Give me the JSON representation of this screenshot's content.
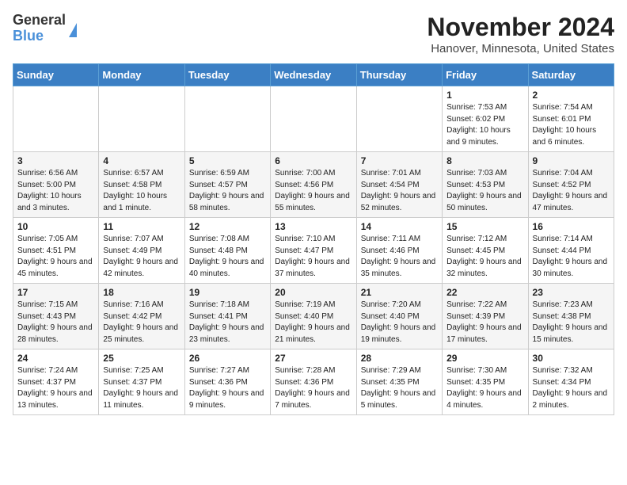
{
  "header": {
    "logo_line1": "General",
    "logo_line2": "Blue",
    "title": "November 2024",
    "subtitle": "Hanover, Minnesota, United States"
  },
  "calendar": {
    "weekdays": [
      "Sunday",
      "Monday",
      "Tuesday",
      "Wednesday",
      "Thursday",
      "Friday",
      "Saturday"
    ],
    "weeks": [
      [
        {
          "day": "",
          "info": ""
        },
        {
          "day": "",
          "info": ""
        },
        {
          "day": "",
          "info": ""
        },
        {
          "day": "",
          "info": ""
        },
        {
          "day": "",
          "info": ""
        },
        {
          "day": "1",
          "info": "Sunrise: 7:53 AM\nSunset: 6:02 PM\nDaylight: 10 hours and 9 minutes."
        },
        {
          "day": "2",
          "info": "Sunrise: 7:54 AM\nSunset: 6:01 PM\nDaylight: 10 hours and 6 minutes."
        }
      ],
      [
        {
          "day": "3",
          "info": "Sunrise: 6:56 AM\nSunset: 5:00 PM\nDaylight: 10 hours and 3 minutes."
        },
        {
          "day": "4",
          "info": "Sunrise: 6:57 AM\nSunset: 4:58 PM\nDaylight: 10 hours and 1 minute."
        },
        {
          "day": "5",
          "info": "Sunrise: 6:59 AM\nSunset: 4:57 PM\nDaylight: 9 hours and 58 minutes."
        },
        {
          "day": "6",
          "info": "Sunrise: 7:00 AM\nSunset: 4:56 PM\nDaylight: 9 hours and 55 minutes."
        },
        {
          "day": "7",
          "info": "Sunrise: 7:01 AM\nSunset: 4:54 PM\nDaylight: 9 hours and 52 minutes."
        },
        {
          "day": "8",
          "info": "Sunrise: 7:03 AM\nSunset: 4:53 PM\nDaylight: 9 hours and 50 minutes."
        },
        {
          "day": "9",
          "info": "Sunrise: 7:04 AM\nSunset: 4:52 PM\nDaylight: 9 hours and 47 minutes."
        }
      ],
      [
        {
          "day": "10",
          "info": "Sunrise: 7:05 AM\nSunset: 4:51 PM\nDaylight: 9 hours and 45 minutes."
        },
        {
          "day": "11",
          "info": "Sunrise: 7:07 AM\nSunset: 4:49 PM\nDaylight: 9 hours and 42 minutes."
        },
        {
          "day": "12",
          "info": "Sunrise: 7:08 AM\nSunset: 4:48 PM\nDaylight: 9 hours and 40 minutes."
        },
        {
          "day": "13",
          "info": "Sunrise: 7:10 AM\nSunset: 4:47 PM\nDaylight: 9 hours and 37 minutes."
        },
        {
          "day": "14",
          "info": "Sunrise: 7:11 AM\nSunset: 4:46 PM\nDaylight: 9 hours and 35 minutes."
        },
        {
          "day": "15",
          "info": "Sunrise: 7:12 AM\nSunset: 4:45 PM\nDaylight: 9 hours and 32 minutes."
        },
        {
          "day": "16",
          "info": "Sunrise: 7:14 AM\nSunset: 4:44 PM\nDaylight: 9 hours and 30 minutes."
        }
      ],
      [
        {
          "day": "17",
          "info": "Sunrise: 7:15 AM\nSunset: 4:43 PM\nDaylight: 9 hours and 28 minutes."
        },
        {
          "day": "18",
          "info": "Sunrise: 7:16 AM\nSunset: 4:42 PM\nDaylight: 9 hours and 25 minutes."
        },
        {
          "day": "19",
          "info": "Sunrise: 7:18 AM\nSunset: 4:41 PM\nDaylight: 9 hours and 23 minutes."
        },
        {
          "day": "20",
          "info": "Sunrise: 7:19 AM\nSunset: 4:40 PM\nDaylight: 9 hours and 21 minutes."
        },
        {
          "day": "21",
          "info": "Sunrise: 7:20 AM\nSunset: 4:40 PM\nDaylight: 9 hours and 19 minutes."
        },
        {
          "day": "22",
          "info": "Sunrise: 7:22 AM\nSunset: 4:39 PM\nDaylight: 9 hours and 17 minutes."
        },
        {
          "day": "23",
          "info": "Sunrise: 7:23 AM\nSunset: 4:38 PM\nDaylight: 9 hours and 15 minutes."
        }
      ],
      [
        {
          "day": "24",
          "info": "Sunrise: 7:24 AM\nSunset: 4:37 PM\nDaylight: 9 hours and 13 minutes."
        },
        {
          "day": "25",
          "info": "Sunrise: 7:25 AM\nSunset: 4:37 PM\nDaylight: 9 hours and 11 minutes."
        },
        {
          "day": "26",
          "info": "Sunrise: 7:27 AM\nSunset: 4:36 PM\nDaylight: 9 hours and 9 minutes."
        },
        {
          "day": "27",
          "info": "Sunrise: 7:28 AM\nSunset: 4:36 PM\nDaylight: 9 hours and 7 minutes."
        },
        {
          "day": "28",
          "info": "Sunrise: 7:29 AM\nSunset: 4:35 PM\nDaylight: 9 hours and 5 minutes."
        },
        {
          "day": "29",
          "info": "Sunrise: 7:30 AM\nSunset: 4:35 PM\nDaylight: 9 hours and 4 minutes."
        },
        {
          "day": "30",
          "info": "Sunrise: 7:32 AM\nSunset: 4:34 PM\nDaylight: 9 hours and 2 minutes."
        }
      ]
    ]
  }
}
